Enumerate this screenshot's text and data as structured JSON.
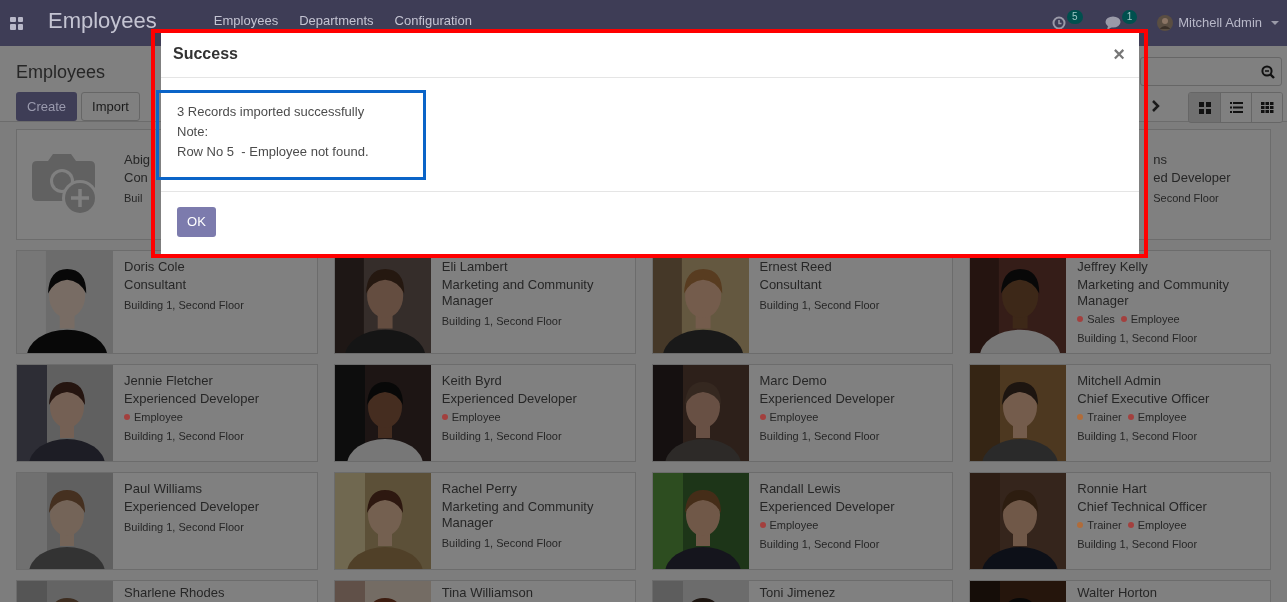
{
  "app": {
    "title": "Employees",
    "menu": [
      "Employees",
      "Departments",
      "Configuration"
    ],
    "activity_count": "5",
    "message_count": "1",
    "user": "Mitchell Admin"
  },
  "control_panel": {
    "breadcrumb": "Employees",
    "create": "Create",
    "import": "Import",
    "views": [
      {
        "kind": "kanban",
        "selected": true
      },
      {
        "kind": "list",
        "selected": false
      },
      {
        "kind": "grid",
        "selected": false
      }
    ]
  },
  "employees": [
    {
      "kind": "placeholder",
      "name": "Abig",
      "job": "Con",
      "location": "Buil"
    },
    {
      "kind": "covered",
      "name": "ns",
      "job": "ed Developer",
      "location": "Second Floor"
    },
    {
      "name": "Doris Cole",
      "job": "Consultant",
      "location": "Building 1, Second Floor"
    },
    {
      "name": "Eli Lambert",
      "job": "Marketing and Community Manager",
      "location": "Building 1, Second Floor"
    },
    {
      "name": "Ernest Reed",
      "job": "Consultant",
      "location": "Building 1, Second Floor"
    },
    {
      "name": "Jeffrey Kelly",
      "job": "Marketing and Community Manager",
      "tags": [
        {
          "label": "Sales",
          "color": "#a3403e"
        },
        {
          "label": "Employee",
          "color": "#a3403e"
        }
      ],
      "location": "Building 1, Second Floor"
    },
    {
      "name": "Jennie Fletcher",
      "job": "Experienced Developer",
      "tags": [
        {
          "label": "Employee",
          "color": "#a3403e"
        }
      ],
      "location": "Building 1, Second Floor"
    },
    {
      "name": "Keith Byrd",
      "job": "Experienced Developer",
      "tags": [
        {
          "label": "Employee",
          "color": "#a3403e"
        }
      ],
      "location": "Building 1, Second Floor"
    },
    {
      "name": "Marc Demo",
      "job": "Experienced Developer",
      "tags": [
        {
          "label": "Employee",
          "color": "#a3403e"
        }
      ],
      "location": "Building 1, Second Floor"
    },
    {
      "name": "Mitchell Admin",
      "job": "Chief Executive Officer",
      "tags": [
        {
          "label": "Trainer",
          "color": "#b06c3a"
        },
        {
          "label": "Employee",
          "color": "#a3403e"
        }
      ],
      "location": "Building 1, Second Floor"
    },
    {
      "name": "Paul Williams",
      "job": "Experienced Developer",
      "location": "Building 1, Second Floor"
    },
    {
      "name": "Rachel Perry",
      "job": "Marketing and Community Manager",
      "location": "Building 1, Second Floor"
    },
    {
      "name": "Randall Lewis",
      "job": "Experienced Developer",
      "tags": [
        {
          "label": "Employee",
          "color": "#a3403e"
        }
      ],
      "location": "Building 1, Second Floor"
    },
    {
      "name": "Ronnie Hart",
      "job": "Chief Technical Officer",
      "tags": [
        {
          "label": "Trainer",
          "color": "#b06c3a"
        },
        {
          "label": "Employee",
          "color": "#a3403e"
        }
      ],
      "location": "Building 1, Second Floor"
    },
    {
      "name": "Sharlene Rhodes"
    },
    {
      "name": "Tina Williamson"
    },
    {
      "name": "Toni Jimenez"
    },
    {
      "name": "Walter Horton"
    }
  ],
  "dialog": {
    "title": "Success",
    "close": "×",
    "lines": [
      "3 Records imported successfully",
      "Note:",
      "Row No 5  - Employee not found."
    ],
    "ok": "OK"
  }
}
